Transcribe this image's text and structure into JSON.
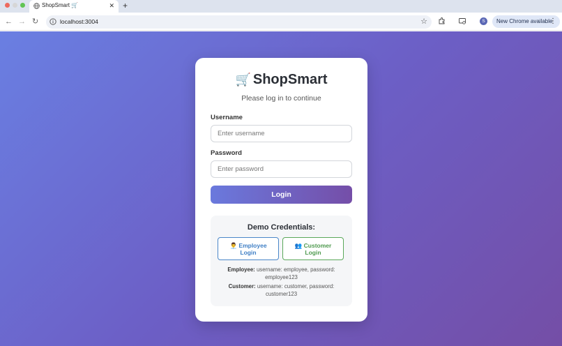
{
  "browser": {
    "tab_title": "ShopSmart 🛒",
    "tab_close": "✕",
    "new_tab": "+",
    "url": "localhost:3004",
    "profile_initial": "S",
    "update_label": "New Chrome available",
    "icons": [
      "back-icon",
      "forward-icon",
      "reload-icon",
      "site-info-icon",
      "star-icon",
      "extensions-icon",
      "cast-icon",
      "menu-icon"
    ]
  },
  "login": {
    "brand_emoji": "🛒",
    "brand_name": "ShopSmart",
    "subtitle": "Please log in to continue",
    "username_label": "Username",
    "username_placeholder": "Enter username",
    "password_label": "Password",
    "password_placeholder": "Enter password",
    "login_button": "Login"
  },
  "demo": {
    "title": "Demo Credentials:",
    "employee_button_icon": "👨‍💼",
    "employee_button": "Employee Login",
    "customer_button_icon": "👥",
    "customer_button": "Customer Login",
    "employee_label": "Employee:",
    "employee_creds": "username: employee, password: employee123",
    "customer_label": "Customer:",
    "customer_creds": "username: customer, password: customer123"
  },
  "colors": {
    "bg_gradient_start": "#6a7fe2",
    "bg_gradient_end": "#744ea6",
    "employee_accent": "#3f7fc5",
    "customer_accent": "#4f9a4f"
  }
}
